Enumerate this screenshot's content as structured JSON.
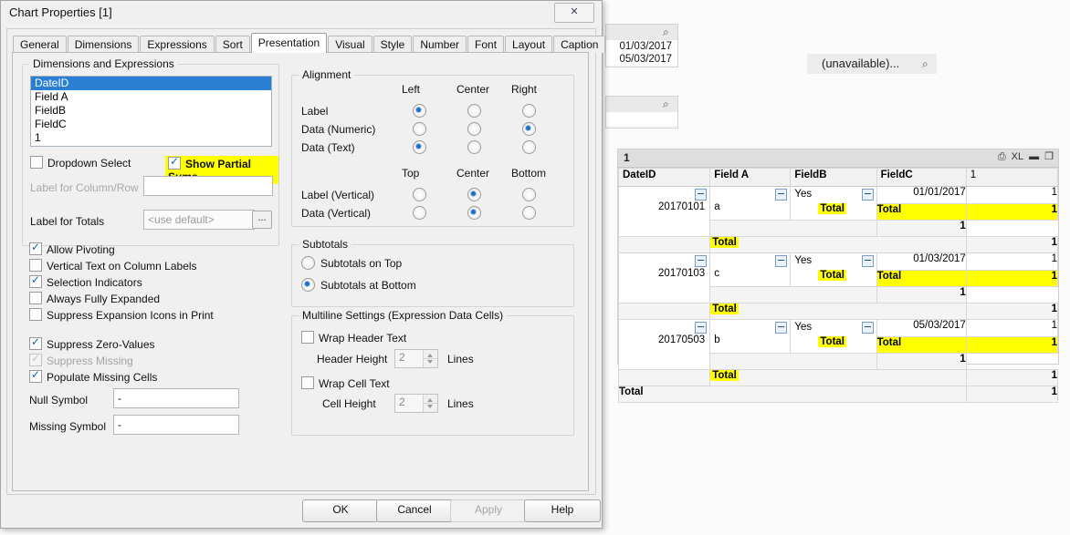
{
  "dialog": {
    "title": "Chart Properties [1]",
    "close_label": "✕",
    "tabs": [
      {
        "label": "General",
        "active": false
      },
      {
        "label": "Dimensions",
        "active": false
      },
      {
        "label": "Expressions",
        "active": false
      },
      {
        "label": "Sort",
        "active": false
      },
      {
        "label": "Presentation",
        "active": true
      },
      {
        "label": "Visual Cues",
        "active": false
      },
      {
        "label": "Style",
        "active": false
      },
      {
        "label": "Number",
        "active": false
      },
      {
        "label": "Font",
        "active": false
      },
      {
        "label": "Layout",
        "active": false
      },
      {
        "label": "Caption",
        "active": false
      }
    ],
    "dims_group": {
      "legend": "Dimensions and Expressions",
      "items": [
        {
          "label": "DateID",
          "selected": true
        },
        {
          "label": "Field A",
          "selected": false
        },
        {
          "label": "FieldB",
          "selected": false
        },
        {
          "label": "FieldC",
          "selected": false
        },
        {
          "label": "1",
          "selected": false
        }
      ],
      "dropdown_select": {
        "label": "Dropdown Select",
        "checked": false
      },
      "show_partial_sums": {
        "label": "Show Partial Sums",
        "checked": true,
        "highlight": true
      },
      "label_column_row": {
        "label": "Label for Column/Row",
        "value": "",
        "disabled": true
      },
      "label_for_totals": {
        "label": "Label for Totals",
        "placeholder": "<use default>",
        "value": "",
        "ellipsis": "..."
      }
    },
    "options": [
      {
        "label": "Allow Pivoting",
        "checked": true,
        "disabled": false
      },
      {
        "label": "Vertical Text on Column Labels",
        "checked": false,
        "disabled": false
      },
      {
        "label": "Selection Indicators",
        "checked": true,
        "disabled": false
      },
      {
        "label": "Always Fully Expanded",
        "checked": false,
        "disabled": false
      },
      {
        "label": "Suppress Expansion Icons in Print",
        "checked": false,
        "disabled": false
      },
      {
        "label": "Suppress Zero-Values",
        "checked": true,
        "disabled": false
      },
      {
        "label": "Suppress Missing",
        "checked": true,
        "disabled": true
      },
      {
        "label": "Populate Missing Cells",
        "checked": true,
        "disabled": false
      }
    ],
    "null_symbol": {
      "label": "Null Symbol",
      "value": "-"
    },
    "missing_symbol": {
      "label": "Missing Symbol",
      "value": "-"
    },
    "alignment": {
      "legend": "Alignment",
      "h_headers": [
        "Left",
        "Center",
        "Right"
      ],
      "v_headers": [
        "Top",
        "Center",
        "Bottom"
      ],
      "h_rows": [
        {
          "label": "Label",
          "selected": "Left"
        },
        {
          "label": "Data (Numeric)",
          "selected": "Right"
        },
        {
          "label": "Data (Text)",
          "selected": "Left"
        }
      ],
      "v_rows": [
        {
          "label": "Label (Vertical)",
          "selected": "Center"
        },
        {
          "label": "Data (Vertical)",
          "selected": "Center"
        }
      ]
    },
    "subtotals": {
      "legend": "Subtotals",
      "options": [
        {
          "label": "Subtotals on Top",
          "selected": false
        },
        {
          "label": "Subtotals at Bottom",
          "selected": true
        }
      ]
    },
    "multiline": {
      "legend": "Multiline Settings (Expression Data Cells)",
      "wrap_header_text": {
        "label": "Wrap Header Text",
        "checked": false
      },
      "header_height": {
        "label": "Header Height",
        "value": "2",
        "unit": "Lines"
      },
      "wrap_cell_text": {
        "label": "Wrap Cell Text",
        "checked": false
      },
      "cell_height": {
        "label": "Cell Height",
        "value": "2",
        "unit": "Lines"
      }
    },
    "buttons": [
      {
        "label": "OK",
        "disabled": false
      },
      {
        "label": "Cancel",
        "disabled": false
      },
      {
        "label": "Apply",
        "disabled": true
      },
      {
        "label": "Help",
        "disabled": false
      }
    ]
  },
  "background": {
    "listbox_top": {
      "rows": [
        "01/03/2017",
        "05/03/2017"
      ],
      "search_icon": "⌕"
    },
    "listbox_mid": {
      "rows": [],
      "search_icon": "⌕"
    },
    "unavailable_box": {
      "text": "(unavailable)...",
      "search_icon": "⌕"
    }
  },
  "pivot": {
    "caption_title": "1",
    "caption_icons": [
      {
        "name": "print-icon",
        "glyph": "⎙"
      },
      {
        "name": "excel-export-icon",
        "glyph": "XL"
      },
      {
        "name": "minimize-icon",
        "glyph": "▬"
      },
      {
        "name": "maximize-icon",
        "glyph": "❐"
      }
    ],
    "columns": [
      "DateID",
      "Field A",
      "FieldB",
      "FieldC",
      "1"
    ],
    "total_label": "Total",
    "expand_glyph": "−",
    "groups": [
      {
        "dateid": "20170101",
        "field_a": "a",
        "fieldb": "Yes",
        "fieldc": "01/01/2017",
        "value_detail": "1",
        "fieldc_total_value": "1",
        "fieldb_total_value": "1",
        "field_a_total_value": "1"
      },
      {
        "dateid": "20170103",
        "field_a": "c",
        "fieldb": "Yes",
        "fieldc": "01/03/2017",
        "value_detail": "1",
        "fieldc_total_value": "1",
        "fieldb_total_value": "1",
        "field_a_total_value": "1"
      },
      {
        "dateid": "20170503",
        "field_a": "b",
        "fieldb": "Yes",
        "fieldc": "05/03/2017",
        "value_detail": "1",
        "fieldc_total_value": "1",
        "fieldb_total_value": "1",
        "field_a_total_value": "1"
      }
    ],
    "grand_total": {
      "label": "Total",
      "value": "1"
    }
  }
}
